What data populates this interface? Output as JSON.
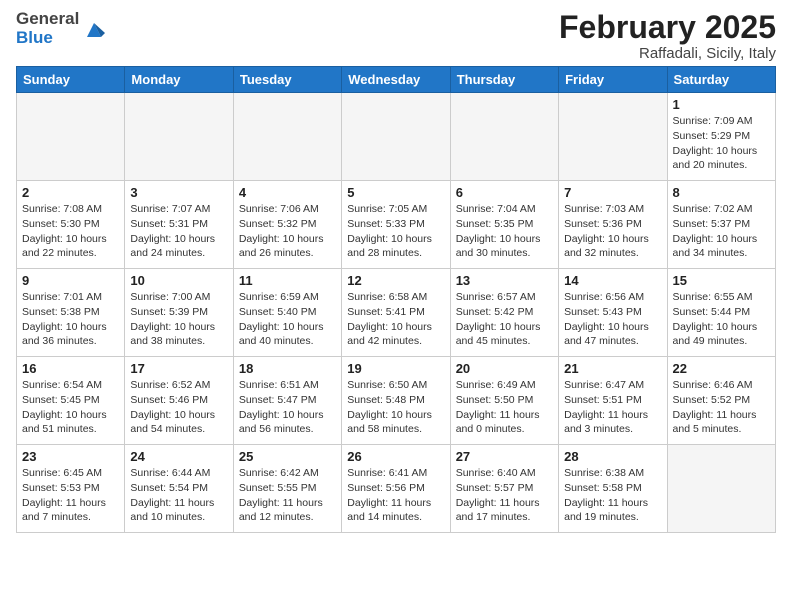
{
  "header": {
    "logo_general": "General",
    "logo_blue": "Blue",
    "month": "February 2025",
    "location": "Raffadali, Sicily, Italy"
  },
  "weekdays": [
    "Sunday",
    "Monday",
    "Tuesday",
    "Wednesday",
    "Thursday",
    "Friday",
    "Saturday"
  ],
  "weeks": [
    [
      {
        "day": "",
        "info": ""
      },
      {
        "day": "",
        "info": ""
      },
      {
        "day": "",
        "info": ""
      },
      {
        "day": "",
        "info": ""
      },
      {
        "day": "",
        "info": ""
      },
      {
        "day": "",
        "info": ""
      },
      {
        "day": "1",
        "info": "Sunrise: 7:09 AM\nSunset: 5:29 PM\nDaylight: 10 hours\nand 20 minutes."
      }
    ],
    [
      {
        "day": "2",
        "info": "Sunrise: 7:08 AM\nSunset: 5:30 PM\nDaylight: 10 hours\nand 22 minutes."
      },
      {
        "day": "3",
        "info": "Sunrise: 7:07 AM\nSunset: 5:31 PM\nDaylight: 10 hours\nand 24 minutes."
      },
      {
        "day": "4",
        "info": "Sunrise: 7:06 AM\nSunset: 5:32 PM\nDaylight: 10 hours\nand 26 minutes."
      },
      {
        "day": "5",
        "info": "Sunrise: 7:05 AM\nSunset: 5:33 PM\nDaylight: 10 hours\nand 28 minutes."
      },
      {
        "day": "6",
        "info": "Sunrise: 7:04 AM\nSunset: 5:35 PM\nDaylight: 10 hours\nand 30 minutes."
      },
      {
        "day": "7",
        "info": "Sunrise: 7:03 AM\nSunset: 5:36 PM\nDaylight: 10 hours\nand 32 minutes."
      },
      {
        "day": "8",
        "info": "Sunrise: 7:02 AM\nSunset: 5:37 PM\nDaylight: 10 hours\nand 34 minutes."
      }
    ],
    [
      {
        "day": "9",
        "info": "Sunrise: 7:01 AM\nSunset: 5:38 PM\nDaylight: 10 hours\nand 36 minutes."
      },
      {
        "day": "10",
        "info": "Sunrise: 7:00 AM\nSunset: 5:39 PM\nDaylight: 10 hours\nand 38 minutes."
      },
      {
        "day": "11",
        "info": "Sunrise: 6:59 AM\nSunset: 5:40 PM\nDaylight: 10 hours\nand 40 minutes."
      },
      {
        "day": "12",
        "info": "Sunrise: 6:58 AM\nSunset: 5:41 PM\nDaylight: 10 hours\nand 42 minutes."
      },
      {
        "day": "13",
        "info": "Sunrise: 6:57 AM\nSunset: 5:42 PM\nDaylight: 10 hours\nand 45 minutes."
      },
      {
        "day": "14",
        "info": "Sunrise: 6:56 AM\nSunset: 5:43 PM\nDaylight: 10 hours\nand 47 minutes."
      },
      {
        "day": "15",
        "info": "Sunrise: 6:55 AM\nSunset: 5:44 PM\nDaylight: 10 hours\nand 49 minutes."
      }
    ],
    [
      {
        "day": "16",
        "info": "Sunrise: 6:54 AM\nSunset: 5:45 PM\nDaylight: 10 hours\nand 51 minutes."
      },
      {
        "day": "17",
        "info": "Sunrise: 6:52 AM\nSunset: 5:46 PM\nDaylight: 10 hours\nand 54 minutes."
      },
      {
        "day": "18",
        "info": "Sunrise: 6:51 AM\nSunset: 5:47 PM\nDaylight: 10 hours\nand 56 minutes."
      },
      {
        "day": "19",
        "info": "Sunrise: 6:50 AM\nSunset: 5:48 PM\nDaylight: 10 hours\nand 58 minutes."
      },
      {
        "day": "20",
        "info": "Sunrise: 6:49 AM\nSunset: 5:50 PM\nDaylight: 11 hours\nand 0 minutes."
      },
      {
        "day": "21",
        "info": "Sunrise: 6:47 AM\nSunset: 5:51 PM\nDaylight: 11 hours\nand 3 minutes."
      },
      {
        "day": "22",
        "info": "Sunrise: 6:46 AM\nSunset: 5:52 PM\nDaylight: 11 hours\nand 5 minutes."
      }
    ],
    [
      {
        "day": "23",
        "info": "Sunrise: 6:45 AM\nSunset: 5:53 PM\nDaylight: 11 hours\nand 7 minutes."
      },
      {
        "day": "24",
        "info": "Sunrise: 6:44 AM\nSunset: 5:54 PM\nDaylight: 11 hours\nand 10 minutes."
      },
      {
        "day": "25",
        "info": "Sunrise: 6:42 AM\nSunset: 5:55 PM\nDaylight: 11 hours\nand 12 minutes."
      },
      {
        "day": "26",
        "info": "Sunrise: 6:41 AM\nSunset: 5:56 PM\nDaylight: 11 hours\nand 14 minutes."
      },
      {
        "day": "27",
        "info": "Sunrise: 6:40 AM\nSunset: 5:57 PM\nDaylight: 11 hours\nand 17 minutes."
      },
      {
        "day": "28",
        "info": "Sunrise: 6:38 AM\nSunset: 5:58 PM\nDaylight: 11 hours\nand 19 minutes."
      },
      {
        "day": "",
        "info": ""
      }
    ]
  ]
}
